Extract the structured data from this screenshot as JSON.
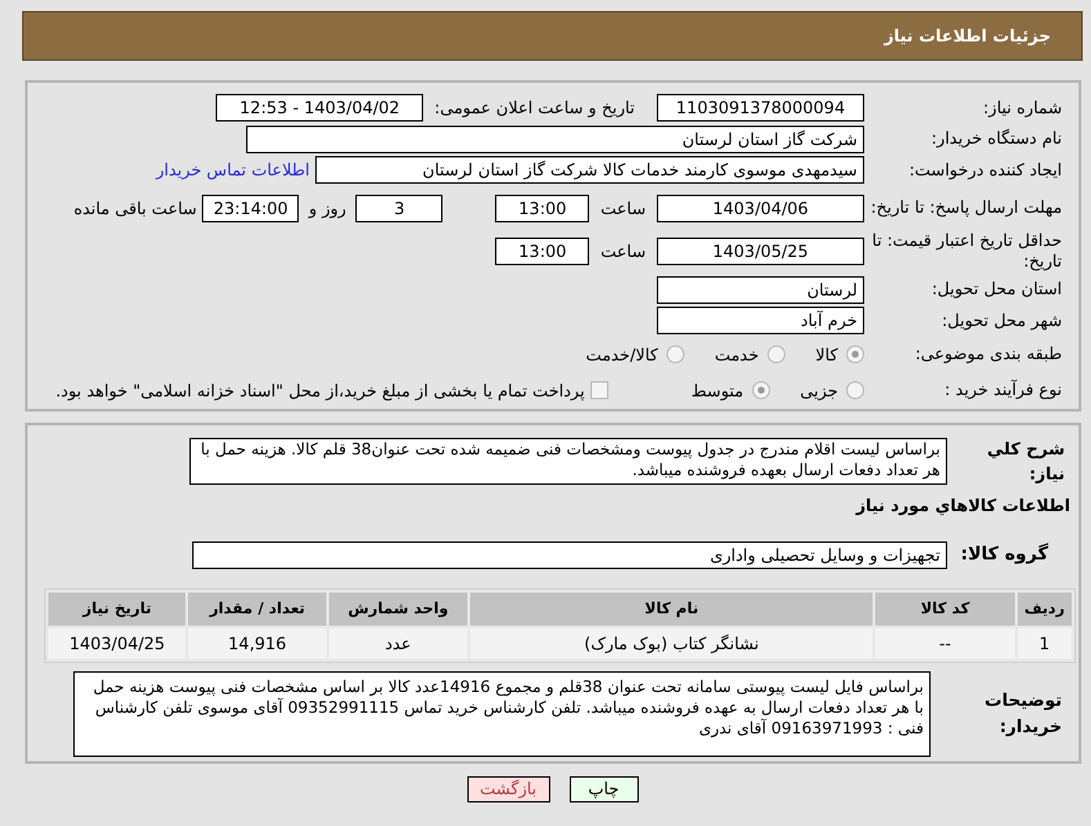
{
  "header": {
    "title": "جزئیات اطلاعات نیاز"
  },
  "need_number": {
    "label": "شماره نیاز:",
    "value": "1103091378000094"
  },
  "announce": {
    "label": "تاریخ و ساعت اعلان عمومی:",
    "value": "1403/04/02 - 12:53"
  },
  "buyer": {
    "label": "نام دستگاه خریدار:",
    "value": "شرکت گاز استان لرستان"
  },
  "requester": {
    "label": "ایجاد کننده درخواست:",
    "value": "سیدمهدی موسوی کارمند خدمات کالا شرکت گاز استان لرستان",
    "link": "اطلاعات تماس خریدار"
  },
  "deadline": {
    "label": "مهلت ارسال پاسخ: تا تاریخ:",
    "date": "1403/04/06",
    "time_label": "ساعت",
    "time": "13:00",
    "days": "3",
    "days_label": "روز و",
    "remaining": "23:14:00",
    "remaining_label": "ساعت باقی مانده"
  },
  "validity": {
    "label": "حداقل تاریخ اعتبار قیمت: تا تاریخ:",
    "date": "1403/05/25",
    "time_label": "ساعت",
    "time": "13:00"
  },
  "province": {
    "label": "استان محل تحویل:",
    "value": "لرستان"
  },
  "city": {
    "label": "شهر محل تحویل:",
    "value": "خرم آباد"
  },
  "category": {
    "label": "طبقه بندی موضوعی:",
    "options": [
      {
        "label": "کالا",
        "selected": true
      },
      {
        "label": "خدمت",
        "selected": false
      },
      {
        "label": "کالا/خدمت",
        "selected": false
      }
    ]
  },
  "purchase_type": {
    "label": "نوع فرآیند خرید :",
    "options": [
      {
        "label": "جزیی",
        "selected": false
      },
      {
        "label": "متوسط",
        "selected": true
      }
    ],
    "payment": {
      "checked": false,
      "label": "پرداخت تمام یا بخشی از مبلغ خرید،از محل \"اسناد خزانه اسلامی\" خواهد بود."
    }
  },
  "description": {
    "label": "شرح کلي نياز:",
    "text": "براساس لیست اقلام مندرج در جدول پیوست ومشخصات فنی ضمیمه شده تحت عنوان38 قلم کالا. هزینه حمل با هر تعداد دفعات ارسال بعهده فروشنده میباشد."
  },
  "goods_title": "اطلاعات کالاهاي مورد نياز",
  "goods_group": {
    "label": "گروه کالا:",
    "value": "تجهیزات و وسایل تحصیلی واداری"
  },
  "table": {
    "columns": [
      "ردیف",
      "کد کالا",
      "نام کالا",
      "واحد شمارش",
      "تعداد / مقدار",
      "تاریخ نیاز"
    ],
    "rows": [
      [
        "1",
        "--",
        "نشانگر کتاب (بوک مارک)",
        "عدد",
        "14,916",
        "1403/04/25"
      ]
    ]
  },
  "buyer_notes": {
    "label": "توضیحات خریدار:",
    "text": "براساس  فایل لیست پیوستی سامانه تحت عنوان 38قلم و مجموع 14916عدد کالا بر اساس مشخصات فنی پیوست هزینه حمل با هر تعداد دفعات ارسال به عهده فروشنده میباشد. تلفن کارشناس خرید تماس 09352991115 آقای موسوی تلفن کارشناس فنی : 09163971993 آقای ندری"
  },
  "buttons": [
    {
      "kind": "print",
      "label": "چاپ"
    },
    {
      "kind": "back",
      "label": "بازگشت"
    }
  ]
}
